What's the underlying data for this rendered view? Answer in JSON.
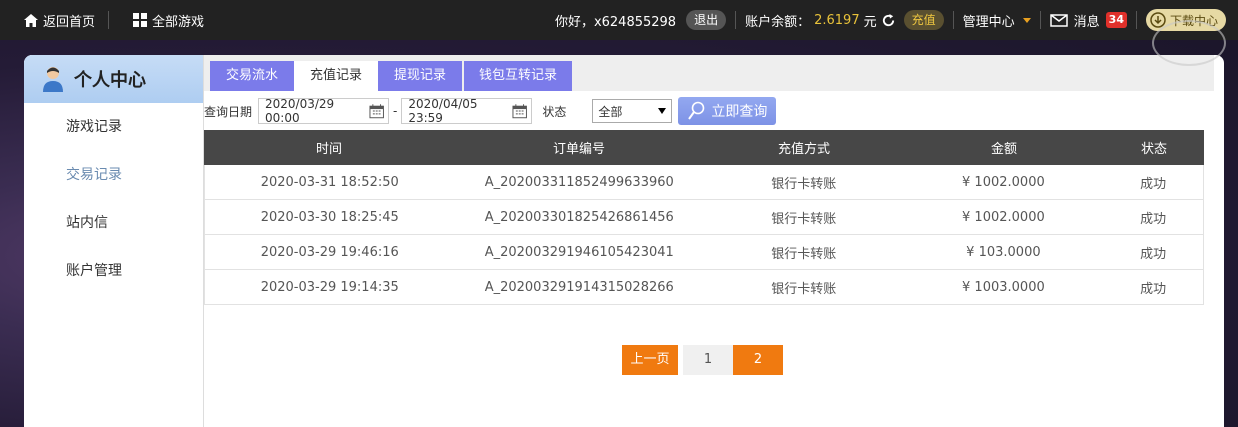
{
  "topbar": {
    "home_label": "返回首页",
    "games_label": "全部游戏",
    "greeting": "你好，x624855298",
    "logout_label": "退出",
    "balance_label": "账户余额：",
    "balance_value": "2.6197",
    "balance_unit": "元",
    "recharge_label": "充值",
    "management_label": "管理中心",
    "messages_label": "消息",
    "messages_count": "34",
    "download_label": "下载中心"
  },
  "sidebar": {
    "title": "个人中心",
    "items": [
      {
        "label": "游戏记录"
      },
      {
        "label": "交易记录"
      },
      {
        "label": "站内信"
      },
      {
        "label": "账户管理"
      }
    ]
  },
  "tabs": [
    {
      "label": "交易流水"
    },
    {
      "label": "充值记录"
    },
    {
      "label": "提现记录"
    },
    {
      "label": "钱包互转记录"
    }
  ],
  "filters": {
    "date_label": "查询日期",
    "date_from": "2020/03/29 00:00",
    "date_to": "2020/04/05 23:59",
    "status_label": "状态",
    "status_value": "全部",
    "query_button": "立即查询"
  },
  "table": {
    "columns": [
      "时间",
      "订单编号",
      "充值方式",
      "金额",
      "状态"
    ],
    "rows": [
      [
        "2020-03-31 18:52:50",
        "A_202003311852499633960",
        "银行卡转账",
        "¥ 1002.0000",
        "成功"
      ],
      [
        "2020-03-30 18:25:45",
        "A_202003301825426861456",
        "银行卡转账",
        "¥ 1002.0000",
        "成功"
      ],
      [
        "2020-03-29 19:46:16",
        "A_202003291946105423041",
        "银行卡转账",
        "¥ 103.0000",
        "成功"
      ],
      [
        "2020-03-29 19:14:35",
        "A_202003291914315028266",
        "银行卡转账",
        "¥ 1003.0000",
        "成功"
      ]
    ]
  },
  "pagination": {
    "prev_label": "上一页",
    "pages": [
      "1",
      "2"
    ],
    "current": "2"
  },
  "colors": {
    "accent_orange": "#f07a10",
    "tab_purple": "#7b7bea",
    "balance_gold": "#e8c23a",
    "badge_red": "#e0302a"
  }
}
